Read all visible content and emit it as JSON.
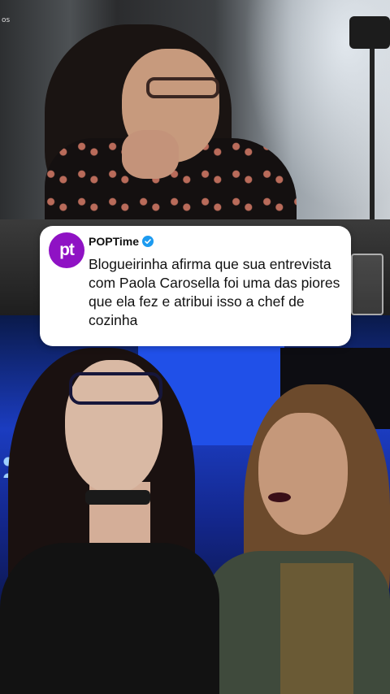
{
  "top_photo": {
    "watermark": "os"
  },
  "tweet": {
    "avatar_initials": "pt",
    "account_name": "POPTime",
    "verified": true,
    "text": "Blogueirinha afirma que sua entrevista com Paola Carosella foi uma das piores que ela fez e atribui isso a chef de cozinha"
  },
  "colors": {
    "avatar_bg": "#8f12c4",
    "verified_badge": "#1d9bf0",
    "card_bg": "#ffffff",
    "text": "#111111"
  },
  "icons": {
    "verified": "verified-check-icon"
  }
}
